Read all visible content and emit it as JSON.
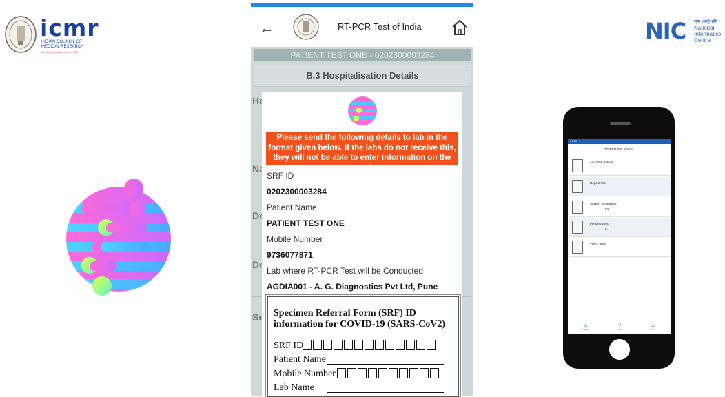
{
  "icmr": {
    "wordmark": "icmr",
    "subtitle_lines": [
      "INDIAN COUNCIL OF",
      "MEDICAL RESEARCH"
    ],
    "tagline": "Serving the nation since 1911"
  },
  "nic": {
    "wordmark": "NIC",
    "text_lines": [
      "एन आई सी",
      "National",
      "Informatics",
      "Centre"
    ]
  },
  "app": {
    "title": "RT-PCR Test of India",
    "patient_bar": "PATIENT TEST ONE - 0202300003284",
    "section_title": "B.3 Hospitalisation Details",
    "background_letters": [
      "Ha",
      "Na",
      "Do",
      "Do",
      "Se"
    ],
    "dialog": {
      "alert": "Please send the following details to lab in the format given below. If the labs do not receive this, they will not be able to enter information on the portal.",
      "fields": [
        {
          "label": "SRF ID",
          "value": "0202300003284"
        },
        {
          "label": "Patient Name",
          "value": "PATIENT TEST ONE"
        },
        {
          "label": "Mobile Number",
          "value": "9736077871"
        },
        {
          "label": "Lab where RT-PCR Test will be Conducted",
          "value": "AGDIA001 - A. G. Diagnostics Pvt Ltd, Pune"
        }
      ],
      "srf_card": {
        "title": "Specimen Referral Form (SRF) ID information for COVID-19 (SARS-CoV2)",
        "srf_id_label": "SRF ID",
        "patient_name_label": "Patient Name",
        "mobile_label": "Mobile Number",
        "lab_name_label": "Lab Name"
      }
    }
  },
  "phone": {
    "status": "17:19",
    "title": "RT-PCR Test of India",
    "menu": [
      {
        "label": "Add New Patient",
        "count": ""
      },
      {
        "label": "Repeat Test",
        "count": ""
      },
      {
        "label": "Saved / Incomplete",
        "count": "83"
      },
      {
        "label": "Pending Sync",
        "count": "0"
      },
      {
        "label": "View Forms",
        "count": ""
      }
    ],
    "nav": [
      "Home",
      "Help",
      "More"
    ]
  },
  "colors": {
    "accent_blue": "#1e88e5",
    "alert_orange": "#f0521e",
    "icmr_blue": "#1a3f9c",
    "nic_blue": "#2b64b8"
  }
}
